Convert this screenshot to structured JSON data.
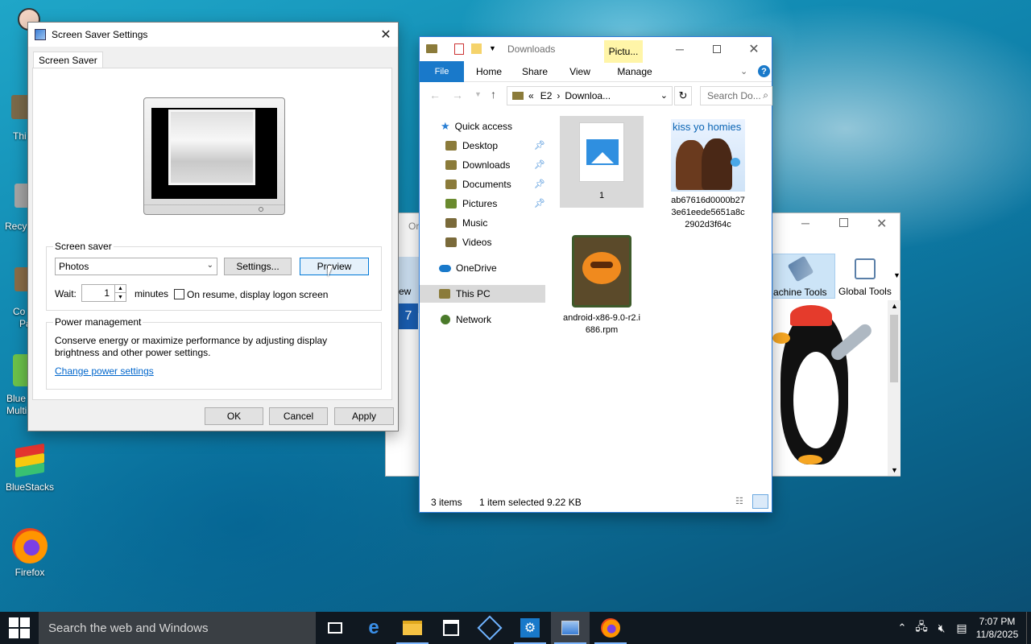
{
  "desktop": {
    "icons": [
      {
        "label": "BlueStacks"
      },
      {
        "label": "Firefox"
      }
    ],
    "partial_labels": [
      "Thi",
      "Recy",
      "Co",
      "Pa",
      "Blue",
      "Multi"
    ]
  },
  "screensaver_dialog": {
    "title": "Screen Saver Settings",
    "tab": "Screen Saver",
    "screensaver_group_label": "Screen saver",
    "selected_screensaver": "Photos",
    "settings_button": "Settings...",
    "preview_button": "Preview",
    "wait_label": "Wait:",
    "wait_value": "1",
    "minutes_label": "minutes",
    "resume_checkbox_label": "On resume, display logon screen",
    "resume_checked": false,
    "power_group_label": "Power management",
    "power_text": "Conserve energy or maximize performance by adjusting display brightness and other power settings.",
    "power_link": "Change power settings",
    "ok_button": "OK",
    "cancel_button": "Cancel",
    "apply_button": "Apply"
  },
  "explorer": {
    "title": "Downloads",
    "context_tab": "Pictu...",
    "ribbon_tabs": [
      "File",
      "Home",
      "Share",
      "View",
      "Manage"
    ],
    "breadcrumb": [
      "E2",
      "Downloa..."
    ],
    "search_placeholder": "Search Do...",
    "nav": {
      "quick_access": "Quick access",
      "quick_items": [
        "Desktop",
        "Downloads",
        "Documents",
        "Pictures",
        "Music",
        "Videos"
      ],
      "onedrive": "OneDrive",
      "this_pc": "This PC",
      "network": "Network"
    },
    "files": [
      {
        "name": "1"
      },
      {
        "name": "ab67616d0000b273e61eede5651a8c2902d3f64c",
        "thumb_text": "kiss yo homies"
      },
      {
        "name": "android-x86-9.0-r2.i686.rpm"
      }
    ],
    "status": {
      "items": "3 items",
      "selected": "1 item selected",
      "size": "9.22 KB"
    }
  },
  "background_window": {
    "partial_title": "Or",
    "partial_left": "ew",
    "tools": [
      "achine Tools",
      "Global Tools"
    ]
  },
  "taskbar": {
    "search_placeholder": "Search the web and Windows",
    "time": "7:07 PM",
    "date": "11/8/2025"
  },
  "colors": {
    "accent": "#0078d7",
    "file_tab": "#1979ca",
    "context_tab": "#fff5a8",
    "taskbar": "#101820"
  }
}
